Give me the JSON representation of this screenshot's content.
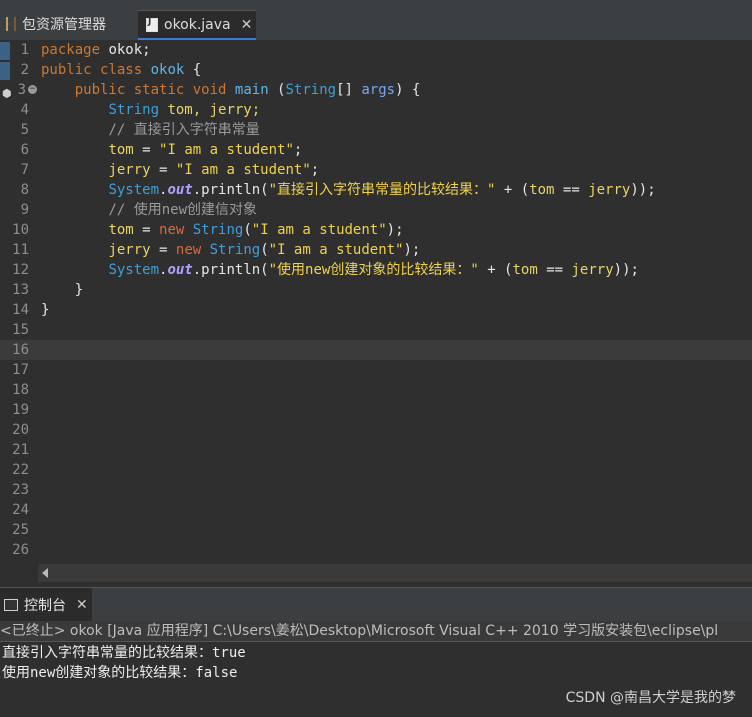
{
  "tabs": {
    "package_explorer": "包资源管理器",
    "editor_file": "okok.java",
    "close_glyph": "✕"
  },
  "editor": {
    "lines": [
      {
        "n": "1"
      },
      {
        "n": "2"
      },
      {
        "n": "3"
      },
      {
        "n": "4"
      },
      {
        "n": "5"
      },
      {
        "n": "6"
      },
      {
        "n": "7"
      },
      {
        "n": "8"
      },
      {
        "n": "9"
      },
      {
        "n": "10"
      },
      {
        "n": "11"
      },
      {
        "n": "12"
      },
      {
        "n": "13"
      },
      {
        "n": "14"
      },
      {
        "n": "15"
      },
      {
        "n": "16"
      },
      {
        "n": "17"
      },
      {
        "n": "18"
      },
      {
        "n": "19"
      },
      {
        "n": "20"
      },
      {
        "n": "21"
      },
      {
        "n": "22"
      },
      {
        "n": "23"
      },
      {
        "n": "24"
      },
      {
        "n": "25"
      },
      {
        "n": "26"
      }
    ],
    "code": {
      "l1_kw": "package",
      "l1_rest": " okok;",
      "l2_kw1": "public",
      "l2_kw2": "class",
      "l2_name": "okok",
      "l2_rest": " {",
      "l3_kw1": "public",
      "l3_kw2": "static",
      "l3_kw3": "void",
      "l3_name": "main",
      "l3_p1": " (",
      "l3_type": "String",
      "l3_p2": "[] ",
      "l3_param": "args",
      "l3_p3": ") {",
      "l4_type": "String",
      "l4_vars": " tom, jerry;",
      "l5_cmt": "// 直接引入字符串常量",
      "l6_var": "tom",
      "l6_op": " = ",
      "l6_str": "\"I am a student\"",
      "l6_end": ";",
      "l7_var": "jerry",
      "l7_op": " = ",
      "l7_str": "\"I am a student\"",
      "l7_end": ";",
      "l8_sys": "System",
      "l8_dot1": ".",
      "l8_out": "out",
      "l8_call": ".println(",
      "l8_str": "\"直接引入字符串常量的比较结果：\"",
      "l8_plus": " + (",
      "l8_a": "tom",
      "l8_eq": " == ",
      "l8_b": "jerry",
      "l8_end": "));",
      "l9_cmt": "// 使用new创建信对象",
      "l10_var": "tom",
      "l10_op": " = ",
      "l10_new": "new",
      "l10_type": " String",
      "l10_p": "(",
      "l10_str": "\"I am a student\"",
      "l10_end": ");",
      "l11_var": "jerry",
      "l11_op": " = ",
      "l11_new": "new",
      "l11_type": " String",
      "l11_p": "(",
      "l11_str": "\"I am a student\"",
      "l11_end": ");",
      "l12_sys": "System",
      "l12_dot1": ".",
      "l12_out": "out",
      "l12_call": ".println(",
      "l12_str": "\"使用new创建对象的比较结果：\"",
      "l12_plus": " + (",
      "l12_a": "tom",
      "l12_eq": " == ",
      "l12_b": "jerry",
      "l12_end": "));",
      "l13": "}",
      "l14": "}"
    }
  },
  "console": {
    "tab_label": "控制台",
    "close_glyph": "✕",
    "status": "<已终止> okok [Java 应用程序] C:\\Users\\姜松\\Desktop\\Microsoft Visual C++ 2010 学习版安装包\\eclipse\\pl",
    "output1": "直接引入字符串常量的比较结果：true",
    "output2": "使用new创建对象的比较结果：false"
  },
  "watermark": "CSDN @南昌大学是我的梦"
}
